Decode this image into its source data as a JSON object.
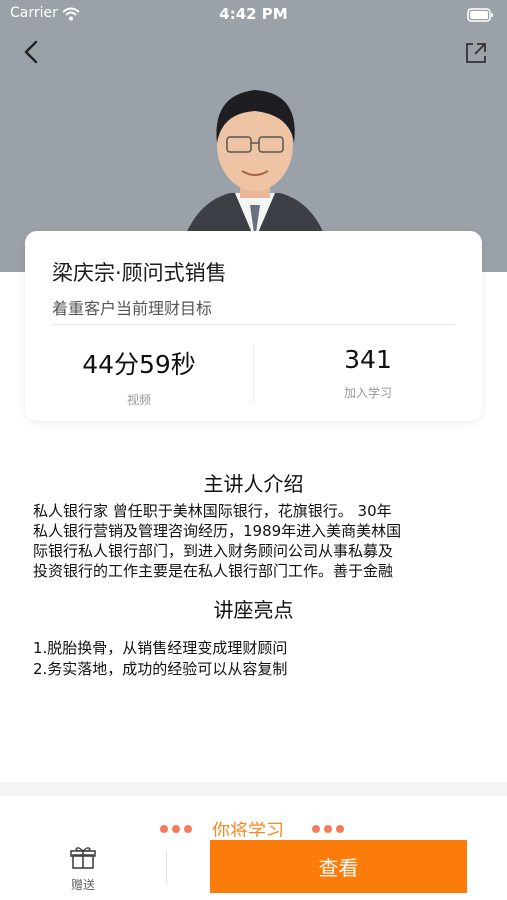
{
  "status_bar": {
    "carrier": "Carrier",
    "time": "4:42 PM"
  },
  "course": {
    "title": "梁庆宗·顾问式销售",
    "subtitle": "着重客户当前理财目标",
    "stats": [
      {
        "value": "44分59秒",
        "label": "视频"
      },
      {
        "value": "341",
        "label": "加入学习"
      }
    ]
  },
  "speaker": {
    "heading": "主讲人介绍",
    "intro_lines": [
      "私人银行家 曾任职于美林国际银行，花旗银行。 30年",
      "私人银行营销及管理咨询经历，1989年进入美商美林国",
      "际银行私人银行部门，到进入财务顾问公司从事私募及",
      "投资银行的工作主要是在私人银行部门工作。善于金融"
    ]
  },
  "highlights": {
    "heading": "讲座亮点",
    "items": [
      "1.脱胎换骨，从销售经理变成理财顾问",
      "2.务实落地，成功的经验可以从容复制"
    ]
  },
  "learn_section": {
    "title": "你将学习"
  },
  "bottom_bar": {
    "gift_label": "赠送",
    "view_label": "查看"
  },
  "colors": {
    "accent": "#fb7c0b",
    "hero_bg": "#9aa1a8"
  },
  "icons": [
    "back-arrow-icon",
    "share-icon",
    "gift-icon",
    "wifi-icon",
    "battery-icon"
  ]
}
